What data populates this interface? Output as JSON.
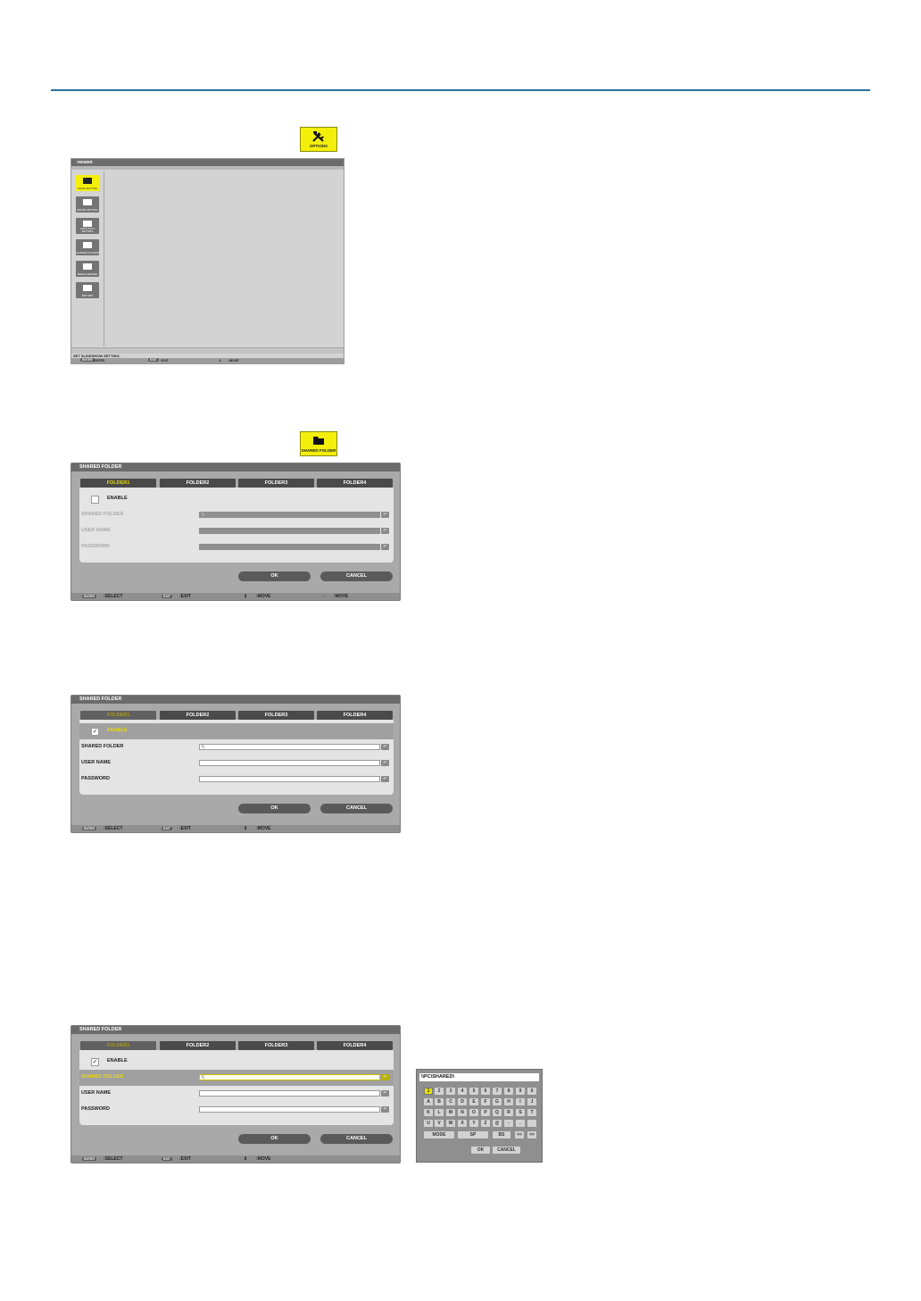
{
  "options_badge": {
    "label": "OPTIONS",
    "icon": "tools-icon"
  },
  "viewer": {
    "title": "VIEWER",
    "menu": [
      {
        "label": "SLIDE SETTING",
        "icon": "slide-icon",
        "selected": true
      },
      {
        "label": "MOVIE SETTING",
        "icon": "film-icon",
        "selected": false
      },
      {
        "label": "AUTO PLAY SETTING",
        "icon": "play-icon",
        "selected": false
      },
      {
        "label": "SHARED FOLDER",
        "icon": "folder-icon",
        "selected": false
      },
      {
        "label": "MEDIA SERVER",
        "icon": "server-icon",
        "selected": false
      },
      {
        "label": "RETURN",
        "icon": "return-icon",
        "selected": false
      }
    ],
    "status": "SET SLIDESHOW SETTING.",
    "foot": {
      "enter_key": "ENTER",
      "enter_text": ":ENTER",
      "exit_key": "EXIT",
      "exit_text": ":EXIT",
      "move_glyph": "⇕",
      "move_text": ":MOVE"
    }
  },
  "shared_badge": {
    "label": "SHARED FOLDER",
    "icon": "folder-icon"
  },
  "dialog_common": {
    "title": "SHARED FOLDER",
    "tabs": [
      "FOLDER1",
      "FOLDER2",
      "FOLDER3",
      "FOLDER4"
    ],
    "enable": "ENABLE",
    "shared_folder": "SHARED FOLDER",
    "user_name": "USER NAME",
    "password": "PASSWORD",
    "path_value": "\\\\",
    "ok": "OK",
    "cancel": "CANCEL",
    "enter_key": "ENTER",
    "select": ":SELECT",
    "exit_key": "EXIT",
    "exit": ":EXIT",
    "move_v": "⇕",
    "move": ":MOVE",
    "move_h": "⇔"
  },
  "keyboard": {
    "input": "\\\\PC\\SHARED\\",
    "rows": [
      [
        "1",
        "2",
        "3",
        "4",
        "5",
        "6",
        "7",
        "8",
        "9",
        "0"
      ],
      [
        "A",
        "B",
        "C",
        "D",
        "E",
        "F",
        "G",
        "H",
        "I",
        "J"
      ],
      [
        "K",
        "L",
        "M",
        "N",
        "O",
        "P",
        "Q",
        "R",
        "S",
        "T"
      ],
      [
        "U",
        "V",
        "W",
        "X",
        "Y",
        "Z",
        "@",
        "-",
        "."
      ]
    ],
    "mode": "MODE",
    "sp": "SP",
    "bs": "BS",
    "left": "<<",
    "right": ">>",
    "ok": "OK",
    "cancel": "CANCEL"
  }
}
